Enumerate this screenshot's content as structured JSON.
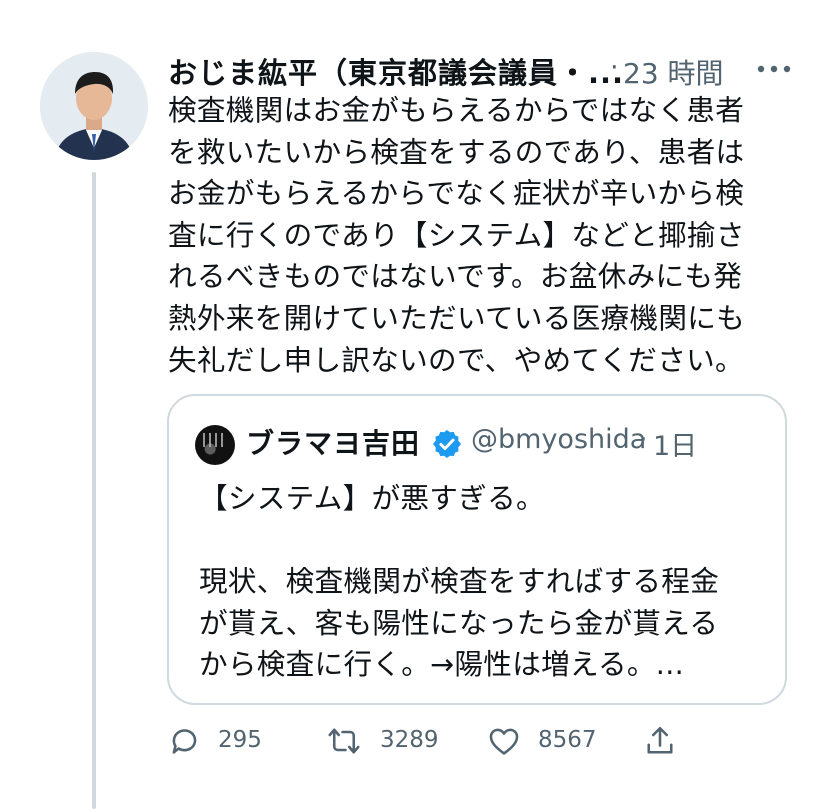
{
  "tweet": {
    "author_name": "おじま紘平（東京都議会議員・...",
    "separator": "·",
    "timestamp": "23 時間",
    "text_lines": [
      "検査機関はお金がもらえるからではなく患者",
      "を救いたいから検査をするのであり、患者は",
      "お金がもらえるからでなく症状が辛いから検",
      "査に行くのであり【システム】などと揶揄さ",
      "れるべきものではないです。お盆休みにも発",
      "熱外来を開けていただいている医療機関にも",
      "失礼だし申し訳ないので、やめてください。"
    ],
    "icons": {
      "more": "more-dots-icon",
      "avatar": "avatar"
    }
  },
  "quote": {
    "name": "ブラマヨ吉田",
    "handle": "@bmyoshida",
    "separator": "·",
    "timestamp": "1日",
    "verified_icon": "verified-badge-icon",
    "paragraph1": "【システム】が悪すぎる。",
    "paragraph2_lines": [
      "現状、検査機関が検査をすればする程金",
      "が貰え、客も陽性になったら金が貰える",
      "から検査に行く。→陽性は増える。..."
    ]
  },
  "actions": {
    "reply": {
      "icon": "reply-icon",
      "count": "295"
    },
    "retweet": {
      "icon": "retweet-icon",
      "count": "3289"
    },
    "like": {
      "icon": "heart-icon",
      "count": "8567"
    },
    "share": {
      "icon": "share-icon"
    }
  },
  "colors": {
    "text": "#0f1419",
    "secondary": "#536471",
    "border": "#cfd9de",
    "verified": "#1d9bf0"
  }
}
